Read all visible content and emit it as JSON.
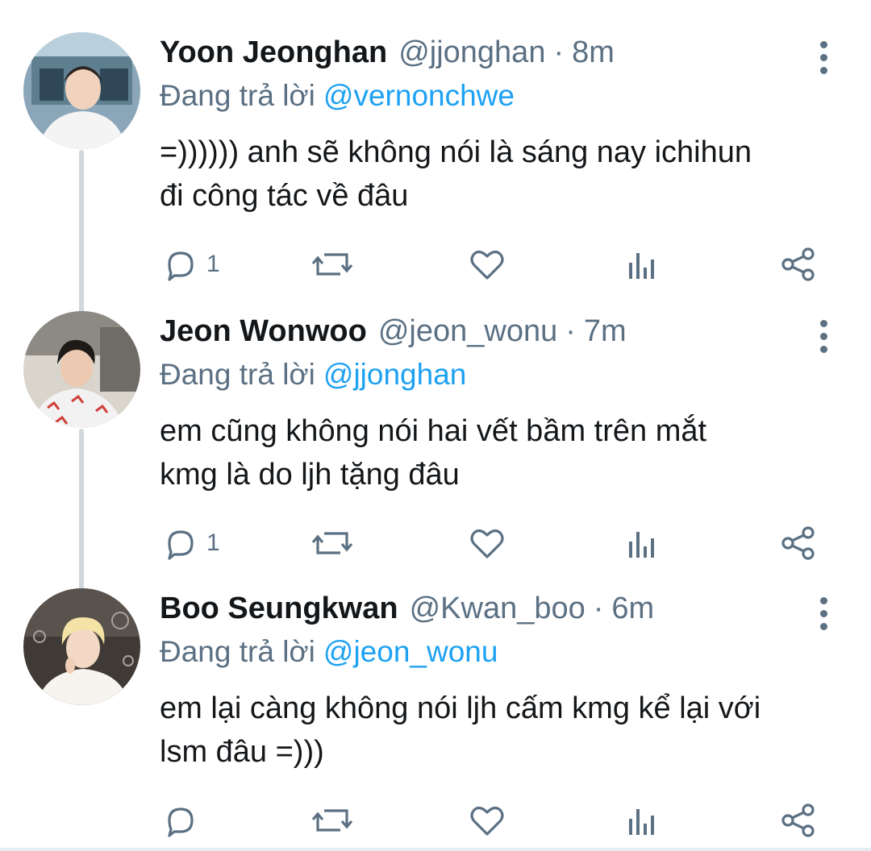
{
  "colors": {
    "accent": "#1da1f2",
    "secondary_text": "#5b7083",
    "primary_text": "#14171a",
    "thread_line": "#cfd9de"
  },
  "reply_prefix": "Đang trả lời",
  "tweets": [
    {
      "name": "Yoon Jeonghan",
      "handle": "@jjonghan",
      "separator": "·",
      "time": "8m",
      "replying_to": "@vernonchwe",
      "text_lines": [
        "=)))))) anh sẽ không nói là sáng nay ichihun",
        "đi công tác về đâu"
      ],
      "reply_count": "1",
      "icons": [
        "reply-icon",
        "retweet-icon",
        "like-icon",
        "analytics-icon",
        "share-icon",
        "more-options-icon"
      ]
    },
    {
      "name": "Jeon Wonwoo",
      "handle": "@jeon_wonu",
      "separator": "·",
      "time": "7m",
      "replying_to": "@jjonghan",
      "text_lines": [
        "em cũng không nói hai vết bầm trên mắt",
        "kmg là do ljh tặng đâu"
      ],
      "reply_count": "1",
      "icons": [
        "reply-icon",
        "retweet-icon",
        "like-icon",
        "analytics-icon",
        "share-icon",
        "more-options-icon"
      ]
    },
    {
      "name": "Boo Seungkwan",
      "handle": "@Kwan_boo",
      "separator": "·",
      "time": "6m",
      "replying_to": "@jeon_wonu",
      "text_lines": [
        "em lại càng không nói ljh cấm kmg kể lại với",
        "lsm đâu =)))"
      ],
      "reply_count": "",
      "icons": [
        "reply-icon",
        "retweet-icon",
        "like-icon",
        "analytics-icon",
        "share-icon",
        "more-options-icon"
      ]
    }
  ]
}
